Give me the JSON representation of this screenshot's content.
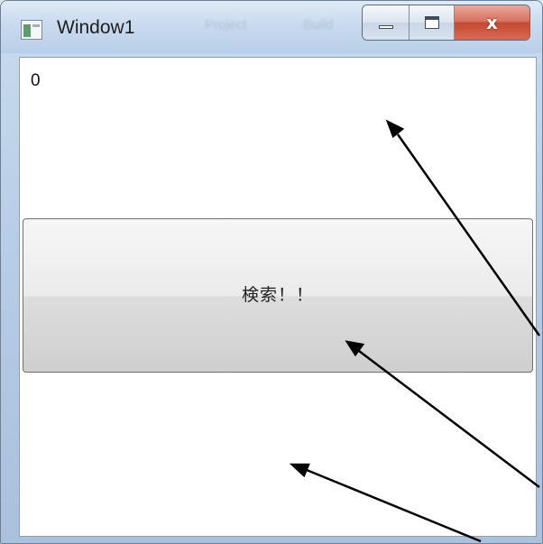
{
  "window": {
    "title": "Window1",
    "faded_menu_items": [
      "Project",
      "Build"
    ]
  },
  "caption_buttons": {
    "minimize_icon": "minimize-icon",
    "maximize_icon": "maximize-icon",
    "close_label": "x"
  },
  "content": {
    "output_text": "0",
    "button_label": "検索！！"
  },
  "annotations": {
    "arrow_color": "#000000",
    "count": 3
  },
  "colors": {
    "title_bar": "#c7d9ee",
    "close_button": "#c44a33",
    "client_background": "#ffffff",
    "button_face": "#e5e5e5"
  }
}
